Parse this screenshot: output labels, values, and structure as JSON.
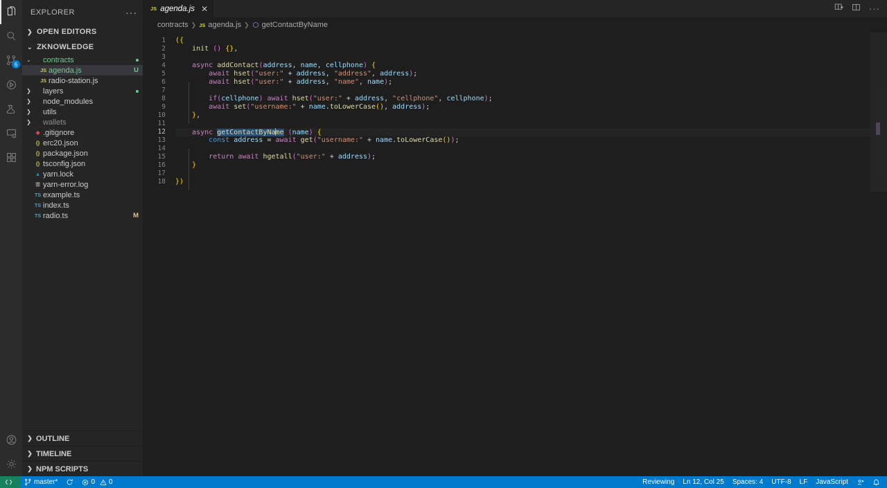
{
  "activitybar": {
    "items": [
      {
        "name": "explorer-icon",
        "title": "Explorer",
        "active": true,
        "badge": ""
      },
      {
        "name": "search-icon",
        "title": "Search",
        "active": false,
        "badge": ""
      },
      {
        "name": "source-control-icon",
        "title": "Source Control",
        "active": false,
        "badge": "6"
      },
      {
        "name": "run-debug-icon",
        "title": "Run and Debug",
        "active": false,
        "badge": ""
      },
      {
        "name": "testing-icon",
        "title": "Testing",
        "active": false,
        "badge": ""
      },
      {
        "name": "remote-explorer-icon",
        "title": "Remote Explorer",
        "active": false,
        "badge": ""
      },
      {
        "name": "extensions-icon",
        "title": "Extensions",
        "active": false,
        "badge": ""
      }
    ],
    "bottom": [
      {
        "name": "account-icon",
        "title": "Accounts"
      },
      {
        "name": "settings-icon",
        "title": "Manage"
      }
    ]
  },
  "sidebar": {
    "title": "EXPLORER",
    "more_label": "···",
    "open_editors_label": "OPEN EDITORS",
    "project_label": "ZKNOWLEDGE",
    "tree": [
      {
        "label": "contracts",
        "icon": "folder",
        "indent": 1,
        "expanded": true,
        "kind": "folder",
        "color": "green",
        "badge": "",
        "dot": "#73c991",
        "selected": false
      },
      {
        "label": "agenda.js",
        "icon": "JS",
        "indent": 2,
        "expanded": null,
        "kind": "file",
        "color": "green",
        "badge": "U",
        "dot": "",
        "selected": true
      },
      {
        "label": "radio-station.js",
        "icon": "JS",
        "indent": 2,
        "expanded": null,
        "kind": "file",
        "color": "",
        "badge": "",
        "dot": "",
        "selected": false
      },
      {
        "label": "layers",
        "icon": "folder",
        "indent": 1,
        "expanded": false,
        "kind": "folder",
        "color": "",
        "badge": "",
        "dot": "#73c991",
        "selected": false
      },
      {
        "label": "node_modules",
        "icon": "folder",
        "indent": 1,
        "expanded": false,
        "kind": "folder",
        "color": "",
        "badge": "",
        "dot": "",
        "selected": false
      },
      {
        "label": "utils",
        "icon": "folder",
        "indent": 1,
        "expanded": false,
        "kind": "folder",
        "color": "",
        "badge": "",
        "dot": "",
        "selected": false
      },
      {
        "label": "wallets",
        "icon": "folder",
        "indent": 1,
        "expanded": false,
        "kind": "folder",
        "color": "grey",
        "badge": "",
        "dot": "",
        "selected": false
      },
      {
        "label": ".gitignore",
        "icon": "git",
        "indent": 1,
        "expanded": null,
        "kind": "file",
        "color": "",
        "badge": "",
        "dot": "",
        "selected": false
      },
      {
        "label": "erc20.json",
        "icon": "{}",
        "indent": 1,
        "expanded": null,
        "kind": "file",
        "color": "",
        "badge": "",
        "dot": "",
        "selected": false
      },
      {
        "label": "package.json",
        "icon": "{}",
        "indent": 1,
        "expanded": null,
        "kind": "file",
        "color": "",
        "badge": "",
        "dot": "",
        "selected": false
      },
      {
        "label": "tsconfig.json",
        "icon": "{}",
        "indent": 1,
        "expanded": null,
        "kind": "file",
        "color": "",
        "badge": "",
        "dot": "",
        "selected": false
      },
      {
        "label": "yarn.lock",
        "icon": "yarn",
        "indent": 1,
        "expanded": null,
        "kind": "file",
        "color": "",
        "badge": "",
        "dot": "",
        "selected": false
      },
      {
        "label": "yarn-error.log",
        "icon": "log",
        "indent": 1,
        "expanded": null,
        "kind": "file",
        "color": "",
        "badge": "",
        "dot": "",
        "selected": false
      },
      {
        "label": "example.ts",
        "icon": "TS",
        "indent": 1,
        "expanded": null,
        "kind": "file",
        "color": "",
        "badge": "",
        "dot": "",
        "selected": false
      },
      {
        "label": "index.ts",
        "icon": "TS",
        "indent": 1,
        "expanded": null,
        "kind": "file",
        "color": "",
        "badge": "",
        "dot": "",
        "selected": false
      },
      {
        "label": "radio.ts",
        "icon": "TS",
        "indent": 1,
        "expanded": null,
        "kind": "file",
        "color": "",
        "badge": "M",
        "dot": "",
        "selected": false
      }
    ],
    "panels": [
      {
        "label": "OUTLINE"
      },
      {
        "label": "TIMELINE"
      },
      {
        "label": "NPM SCRIPTS"
      }
    ]
  },
  "editor": {
    "tab": {
      "icon_label": "JS",
      "name": "agenda.js",
      "close": "✕",
      "dirty": false
    },
    "actions": [
      {
        "name": "split-editor-icon"
      },
      {
        "name": "editor-layout-icon"
      },
      {
        "name": "more-actions-icon",
        "glyph": "···"
      }
    ],
    "breadcrumb": [
      {
        "label": "contracts",
        "icon": ""
      },
      {
        "label": "agenda.js",
        "icon": "JS"
      },
      {
        "label": "getContactByName",
        "icon": "symbol-method"
      }
    ],
    "breadcrumb_separator": "❯",
    "cursor_line": 12,
    "lines": [
      {
        "n": 1,
        "indent": 0,
        "tokens": [
          {
            "t": "({",
            "c": "brkt1"
          }
        ]
      },
      {
        "n": 2,
        "indent": 1,
        "tokens": [
          {
            "t": "init ",
            "c": "fn"
          },
          {
            "t": "()",
            "c": "brkt2"
          },
          {
            "t": " ",
            "c": "pun"
          },
          {
            "t": "{}",
            "c": "brkt1"
          },
          {
            "t": ",",
            "c": "pun"
          }
        ]
      },
      {
        "n": 3,
        "indent": 0,
        "tokens": []
      },
      {
        "n": 4,
        "indent": 1,
        "tokens": [
          {
            "t": "async ",
            "c": "kw"
          },
          {
            "t": "addContact",
            "c": "fn"
          },
          {
            "t": "(",
            "c": "brkt2"
          },
          {
            "t": "address",
            "c": "var"
          },
          {
            "t": ", ",
            "c": "pun"
          },
          {
            "t": "name",
            "c": "var"
          },
          {
            "t": ", ",
            "c": "pun"
          },
          {
            "t": "cellphone",
            "c": "var"
          },
          {
            "t": ")",
            "c": "brkt2"
          },
          {
            "t": " ",
            "c": "pun"
          },
          {
            "t": "{",
            "c": "brkt1"
          }
        ]
      },
      {
        "n": 5,
        "indent": 2,
        "tokens": [
          {
            "t": "await ",
            "c": "kw"
          },
          {
            "t": "hset",
            "c": "fn"
          },
          {
            "t": "(",
            "c": "brkt2"
          },
          {
            "t": "\"user:\"",
            "c": "str"
          },
          {
            "t": " + ",
            "c": "pun"
          },
          {
            "t": "address",
            "c": "var"
          },
          {
            "t": ", ",
            "c": "pun"
          },
          {
            "t": "\"address\"",
            "c": "str"
          },
          {
            "t": ", ",
            "c": "pun"
          },
          {
            "t": "address",
            "c": "var"
          },
          {
            "t": ")",
            "c": "brkt2"
          },
          {
            "t": ";",
            "c": "pun"
          }
        ]
      },
      {
        "n": 6,
        "indent": 2,
        "tokens": [
          {
            "t": "await ",
            "c": "kw"
          },
          {
            "t": "hset",
            "c": "fn"
          },
          {
            "t": "(",
            "c": "brkt2"
          },
          {
            "t": "\"user:\"",
            "c": "str"
          },
          {
            "t": " + ",
            "c": "pun"
          },
          {
            "t": "address",
            "c": "var"
          },
          {
            "t": ", ",
            "c": "pun"
          },
          {
            "t": "\"name\"",
            "c": "str"
          },
          {
            "t": ", ",
            "c": "pun"
          },
          {
            "t": "name",
            "c": "var"
          },
          {
            "t": ")",
            "c": "brkt2"
          },
          {
            "t": ";",
            "c": "pun"
          }
        ]
      },
      {
        "n": 7,
        "indent": 0,
        "tokens": []
      },
      {
        "n": 8,
        "indent": 2,
        "tokens": [
          {
            "t": "if",
            "c": "kw"
          },
          {
            "t": "(",
            "c": "brkt2"
          },
          {
            "t": "cellphone",
            "c": "var"
          },
          {
            "t": ")",
            "c": "brkt2"
          },
          {
            "t": " ",
            "c": "pun"
          },
          {
            "t": "await ",
            "c": "kw"
          },
          {
            "t": "hset",
            "c": "fn"
          },
          {
            "t": "(",
            "c": "brkt2"
          },
          {
            "t": "\"user:\"",
            "c": "str"
          },
          {
            "t": " + ",
            "c": "pun"
          },
          {
            "t": "address",
            "c": "var"
          },
          {
            "t": ", ",
            "c": "pun"
          },
          {
            "t": "\"cellphone\"",
            "c": "str"
          },
          {
            "t": ", ",
            "c": "pun"
          },
          {
            "t": "cellphone",
            "c": "var"
          },
          {
            "t": ")",
            "c": "brkt2"
          },
          {
            "t": ";",
            "c": "pun"
          }
        ]
      },
      {
        "n": 9,
        "indent": 2,
        "tokens": [
          {
            "t": "await ",
            "c": "kw"
          },
          {
            "t": "set",
            "c": "fn"
          },
          {
            "t": "(",
            "c": "brkt2"
          },
          {
            "t": "\"username:\"",
            "c": "str"
          },
          {
            "t": " + ",
            "c": "pun"
          },
          {
            "t": "name",
            "c": "var"
          },
          {
            "t": ".",
            "c": "pun"
          },
          {
            "t": "toLowerCase",
            "c": "fn"
          },
          {
            "t": "()",
            "c": "brkt1"
          },
          {
            "t": ", ",
            "c": "pun"
          },
          {
            "t": "address",
            "c": "var"
          },
          {
            "t": ")",
            "c": "brkt2"
          },
          {
            "t": ";",
            "c": "pun"
          }
        ]
      },
      {
        "n": 10,
        "indent": 1,
        "tokens": [
          {
            "t": "}",
            "c": "brkt1"
          },
          {
            "t": ",",
            "c": "pun"
          }
        ]
      },
      {
        "n": 11,
        "indent": 0,
        "tokens": []
      },
      {
        "n": 12,
        "indent": 1,
        "tokens": [
          {
            "t": "async ",
            "c": "kw"
          },
          {
            "t": "getContactByNa",
            "c": "fn sel"
          },
          {
            "t": "CURSOR",
            "c": "cursor"
          },
          {
            "t": "me",
            "c": "fn sel"
          },
          {
            "t": " ",
            "c": "pun"
          },
          {
            "t": "(",
            "c": "brkt2"
          },
          {
            "t": "name",
            "c": "var"
          },
          {
            "t": ")",
            "c": "brkt2"
          },
          {
            "t": " ",
            "c": "pun"
          },
          {
            "t": "{",
            "c": "brkt1"
          }
        ]
      },
      {
        "n": 13,
        "indent": 2,
        "tokens": [
          {
            "t": "const ",
            "c": "decl"
          },
          {
            "t": "address",
            "c": "var"
          },
          {
            "t": " = ",
            "c": "pun"
          },
          {
            "t": "await ",
            "c": "kw"
          },
          {
            "t": "get",
            "c": "fn"
          },
          {
            "t": "(",
            "c": "brkt2"
          },
          {
            "t": "\"username:\"",
            "c": "str"
          },
          {
            "t": " + ",
            "c": "pun"
          },
          {
            "t": "name",
            "c": "var"
          },
          {
            "t": ".",
            "c": "pun"
          },
          {
            "t": "toLowerCase",
            "c": "fn"
          },
          {
            "t": "()",
            "c": "brkt1"
          },
          {
            "t": ")",
            "c": "brkt2"
          },
          {
            "t": ";",
            "c": "pun"
          }
        ]
      },
      {
        "n": 14,
        "indent": 0,
        "tokens": []
      },
      {
        "n": 15,
        "indent": 2,
        "tokens": [
          {
            "t": "return ",
            "c": "kw"
          },
          {
            "t": "await ",
            "c": "kw"
          },
          {
            "t": "hgetall",
            "c": "fn"
          },
          {
            "t": "(",
            "c": "brkt2"
          },
          {
            "t": "\"user:\"",
            "c": "str"
          },
          {
            "t": " + ",
            "c": "pun"
          },
          {
            "t": "address",
            "c": "var"
          },
          {
            "t": ")",
            "c": "brkt2"
          },
          {
            "t": ";",
            "c": "pun"
          }
        ]
      },
      {
        "n": 16,
        "indent": 1,
        "tokens": [
          {
            "t": "}",
            "c": "brkt1"
          }
        ]
      },
      {
        "n": 17,
        "indent": 0,
        "tokens": []
      },
      {
        "n": 18,
        "indent": 0,
        "tokens": [
          {
            "t": "})",
            "c": "brkt1"
          }
        ]
      }
    ]
  },
  "statusbar": {
    "remote_label": "",
    "branch": "master*",
    "sync_label": "",
    "errors": "0",
    "warnings": "0",
    "right": [
      {
        "name": "status-reviewing",
        "label": "Reviewing"
      },
      {
        "name": "status-cursor-pos",
        "label": "Ln 12, Col 25"
      },
      {
        "name": "status-indent",
        "label": "Spaces: 4"
      },
      {
        "name": "status-encoding",
        "label": "UTF-8"
      },
      {
        "name": "status-eol",
        "label": "LF"
      },
      {
        "name": "status-language",
        "label": "JavaScript"
      }
    ],
    "feedback_icon": "smiley-icon",
    "bell_icon": "bell-icon"
  },
  "colors": {
    "accent": "#007acc",
    "remote": "#16825d",
    "sidebar_bg": "#252526",
    "editor_bg": "#1e1e1e",
    "activitybar_bg": "#2c2c2c",
    "selection": "#264f78",
    "git_untracked": "#73c991"
  }
}
